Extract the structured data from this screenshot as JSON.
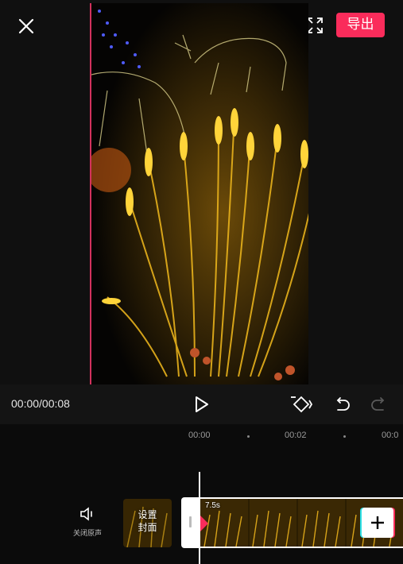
{
  "header": {
    "close_icon": "close-icon",
    "fullscreen_icon": "fullscreen-icon",
    "export_label": "导出",
    "export_color": "#fa2c5b"
  },
  "playback": {
    "timecode": "00:00/00:08",
    "play_icon": "play-icon",
    "keyframe_icon": "keyframe-icon",
    "undo_icon": "undo-icon",
    "redo_icon": "redo-icon"
  },
  "timeline": {
    "ruler": [
      "00:00",
      "00:02",
      "00:0"
    ],
    "audio_toggle_icon": "speaker-icon",
    "audio_toggle_label": "关闭原声",
    "cover_label_line1": "设置",
    "cover_label_line2": "封面",
    "clip_duration": "7.5s",
    "add_clip_icon": "plus-icon"
  }
}
